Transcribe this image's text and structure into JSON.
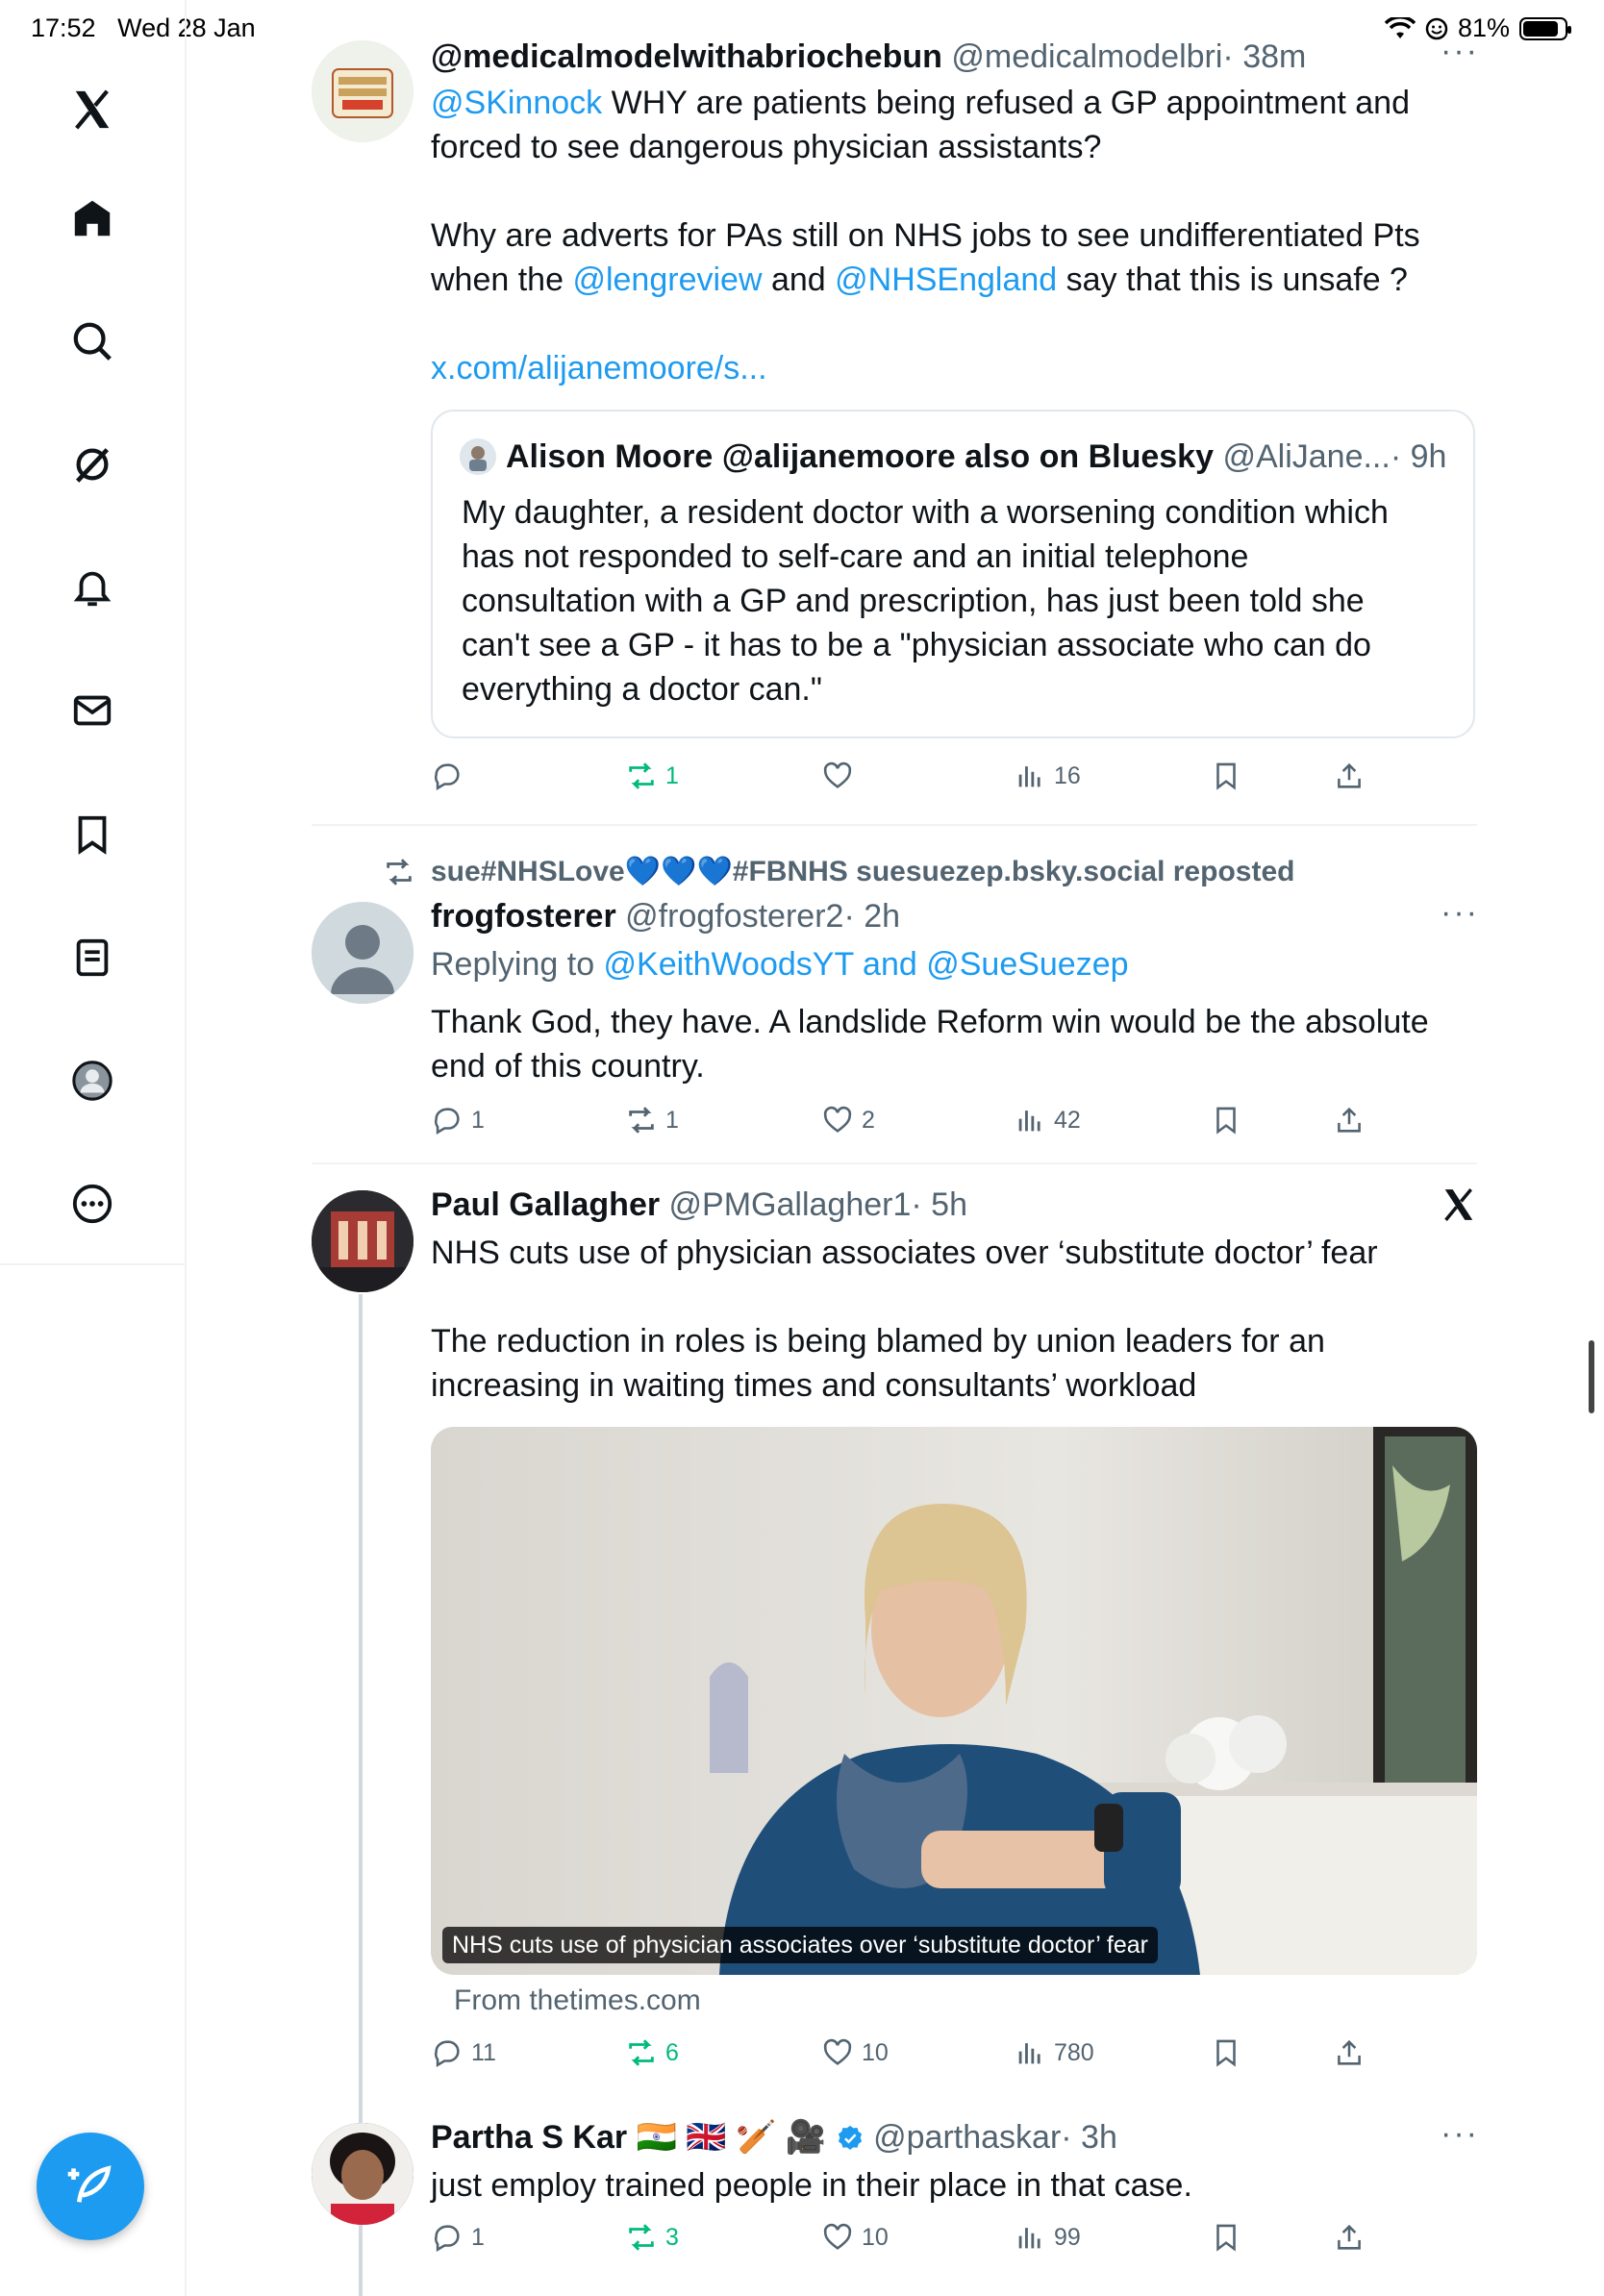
{
  "status": {
    "time": "17:52",
    "date": "Wed 28 Jan",
    "battery": "81%",
    "battery_level": 0.81
  },
  "nav": [
    "x-logo-icon",
    "home-icon",
    "search-icon",
    "grok-icon",
    "notifications-icon",
    "messages-icon",
    "bookmarks-icon",
    "lists-icon",
    "profile-icon",
    "more-icon"
  ],
  "tweets": [
    {
      "name": "@medicalmodelwithabriochebun",
      "handle": "@medicalmodelbri",
      "time": "· 38m",
      "line1_mention": "@SKinnock",
      "line1_text": " WHY are patients being refused a GP appointment and",
      "line2": "forced to see dangerous physician assistants?",
      "line3": "Why are adverts for PAs still on NHS jobs to see undifferentiated Pts",
      "line4_pre": "when the ",
      "line4_m1": "@lengreview",
      "line4_mid": " and ",
      "line4_m2": "@NHSEngland",
      "line4_post": " say that this is unsafe ?",
      "url": "x.com/alijanemoore/s...",
      "quote": {
        "name": "Alison Moore @alijanemoore also on Bluesky",
        "handle": "@AliJane...",
        "time": "· 9h",
        "lines": [
          "My daughter, a resident doctor with a worsening condition which",
          "has not responded to self-care and an initial telephone",
          "consultation with a GP and prescription, has just been told she",
          "can't see a GP - it has to be a \"physician associate who can do",
          "everything a doctor can.\""
        ]
      },
      "replies": "",
      "reposts": "1",
      "likes": "",
      "views": "16"
    },
    {
      "repost_banner": "sue#NHSLove💙💙💙#FBNHS suesuezep.bsky.social reposted",
      "name": "frogfosterer",
      "handle": "@frogfosterer2",
      "time": "· 2h",
      "replying_prefix": "Replying to ",
      "replying_to": "@KeithWoodsYT and @SueSuezep",
      "lines": [
        "Thank God, they have. A landslide Reform win would be the absolute",
        "end of this country."
      ],
      "replies": "1",
      "reposts": "1",
      "likes": "2",
      "views": "42"
    },
    {
      "name": "Paul Gallagher",
      "handle": "@PMGallagher1",
      "time": "· 5h",
      "line1": "NHS cuts use of physician associates over ‘substitute doctor’ fear",
      "line2": "The reduction in roles is being blamed by union leaders for an",
      "line3": "increasing in waiting times and consultants’ workload",
      "card_caption": "NHS cuts use of physician associates over ‘substitute doctor’ fear",
      "card_source": "From thetimes.com",
      "replies": "11",
      "reposts": "6",
      "likes": "10",
      "views": "780"
    },
    {
      "name": "Partha S Kar 🇮🇳 🇬🇧 🏏 🎥",
      "handle": "@parthaskar",
      "time": "· 3h",
      "line1": "just employ trained people in their place in that case.",
      "replies": "1",
      "reposts": "3",
      "likes": "10",
      "views": "99"
    }
  ]
}
